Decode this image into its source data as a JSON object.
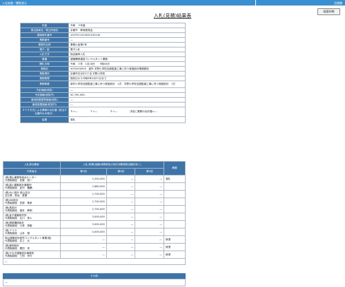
{
  "topbar": {
    "left": "入札結果／閲覧表示",
    "right": "且閉鎖"
  },
  "print_button": "画面印刷",
  "title": "入札(見積)結果表",
  "info_rows": [
    {
      "label": "年度",
      "value": "令和　３年度"
    },
    {
      "label": "発注部局名／発注所属名",
      "value": "京都市　教育委員会"
    },
    {
      "label": "調達案件番号",
      "value": "1007011203020230140"
    },
    {
      "label": "業務番号",
      "value": "―"
    },
    {
      "label": "業務件名称",
      "value": "乗務小倉第1号"
    },
    {
      "label": "電子／紙",
      "value": "電子入札"
    },
    {
      "label": "入札方式",
      "value": "指名競争入札"
    },
    {
      "label": "業種",
      "value": "建築関係建設コンサルタント業務"
    },
    {
      "label": "開札日時",
      "value": "令和　３年　1月18日　　9時00分"
    },
    {
      "label": "業務名",
      "value": "5052000000　部外 宇野小学校支館監査工事に伴う実施設計業務委託"
    },
    {
      "label": "業務場所",
      "value": "京都市右京中2丁目 宇野小学校"
    },
    {
      "label": "業務期間",
      "value": "契約日から令和6年3月21日まで"
    },
    {
      "label": "業務概要",
      "value": "部外小学校支館監査工事に伴う実施設計　1式　宇野小学校支館監査工事に伴う実施設計　1式"
    },
    {
      "label": "予定価格(税抜)",
      "value": "―"
    },
    {
      "label": "予定価格(税抜円)",
      "value": "¥2,700,000-"
    },
    {
      "label": "最低制限基準価格(税抜)",
      "value": "―"
    },
    {
      "label": "最低制限価格(税抜円)",
      "value": "―"
    },
    {
      "label": "ＸＹＺ方式による業務の合計額（該当する箇所のみ表示）",
      "value": "Ｘ＝―　　　　　Ｙ＝―　　　　　Ｚ＝―　　　　　決定に業務の合計額＝―"
    },
    {
      "label": "結果",
      "value": "落札"
    }
  ],
  "bid_table": {
    "h_bidder": "入札参加業者",
    "h_price": "入札(見積)金額(消費税及び地方消費税相当額を除く)",
    "h_remarks": "摘要",
    "h_name": "代表者名",
    "rounds": [
      "第1回",
      "第2回",
      "第3回"
    ],
    "rows": [
      {
        "name": "(株)現山事業所総合センター\n代表取締役　佐藤　詔一",
        "r1": "2,200,000",
        "r2": "―",
        "r3": "―",
        "remark": "落札"
      },
      {
        "name": "(株)高川建築設計事務所\n代表取締役　武村　義輔",
        "r1": "2,680,000",
        "r2": "―",
        "r3": "―",
        "remark": ""
      },
      {
        "name": "(株)みい設計 部山支社\n支社長　新谷　直樹",
        "r1": "2,700,000",
        "r2": "―",
        "r3": "―",
        "remark": ""
      },
      {
        "name": "(株)IBS設計\n代表取締役　笠原　尊彦",
        "r1": "2,700,000",
        "r2": "―",
        "r3": "―",
        "remark": ""
      },
      {
        "name": "(株)馬設計\n代表取締役　橋本　教明",
        "r1": "2,700,000",
        "r2": "―",
        "r3": "―",
        "remark": ""
      },
      {
        "name": "(株)金子建築研究所\n代表取締役　石川　秀人",
        "r1": "3,000,000",
        "r2": "―",
        "r3": "―",
        "remark": ""
      },
      {
        "name": "(株)桐原構造設計\n代表取締役　小林　秀樹",
        "r1": "3,000,000",
        "r2": "―",
        "r3": "―",
        "remark": ""
      },
      {
        "name": "(株)アコラ\n代表取締役　山本　優",
        "r1": "4,000,000",
        "r2": "―",
        "r3": "―",
        "remark": ""
      },
      {
        "name": "岡山建築設計研究コンサルタント事業(個)\n代表取締役　井上　元",
        "r1": "―",
        "r2": "―",
        "r3": "―",
        "remark": "辞退"
      },
      {
        "name": "(株)都和設計\n代表取締役　廣田　亮",
        "r1": "―",
        "r2": "―",
        "r3": "―",
        "remark": "辞退"
      },
      {
        "name": "(株)やなぎ建築設計事務所\n代表取締役　三田　作行",
        "r1": "―",
        "r2": "―",
        "r3": "―",
        "remark": "辞退"
      }
    ],
    "footer": "―"
  },
  "other": {
    "label": "その他",
    "value": "―"
  }
}
